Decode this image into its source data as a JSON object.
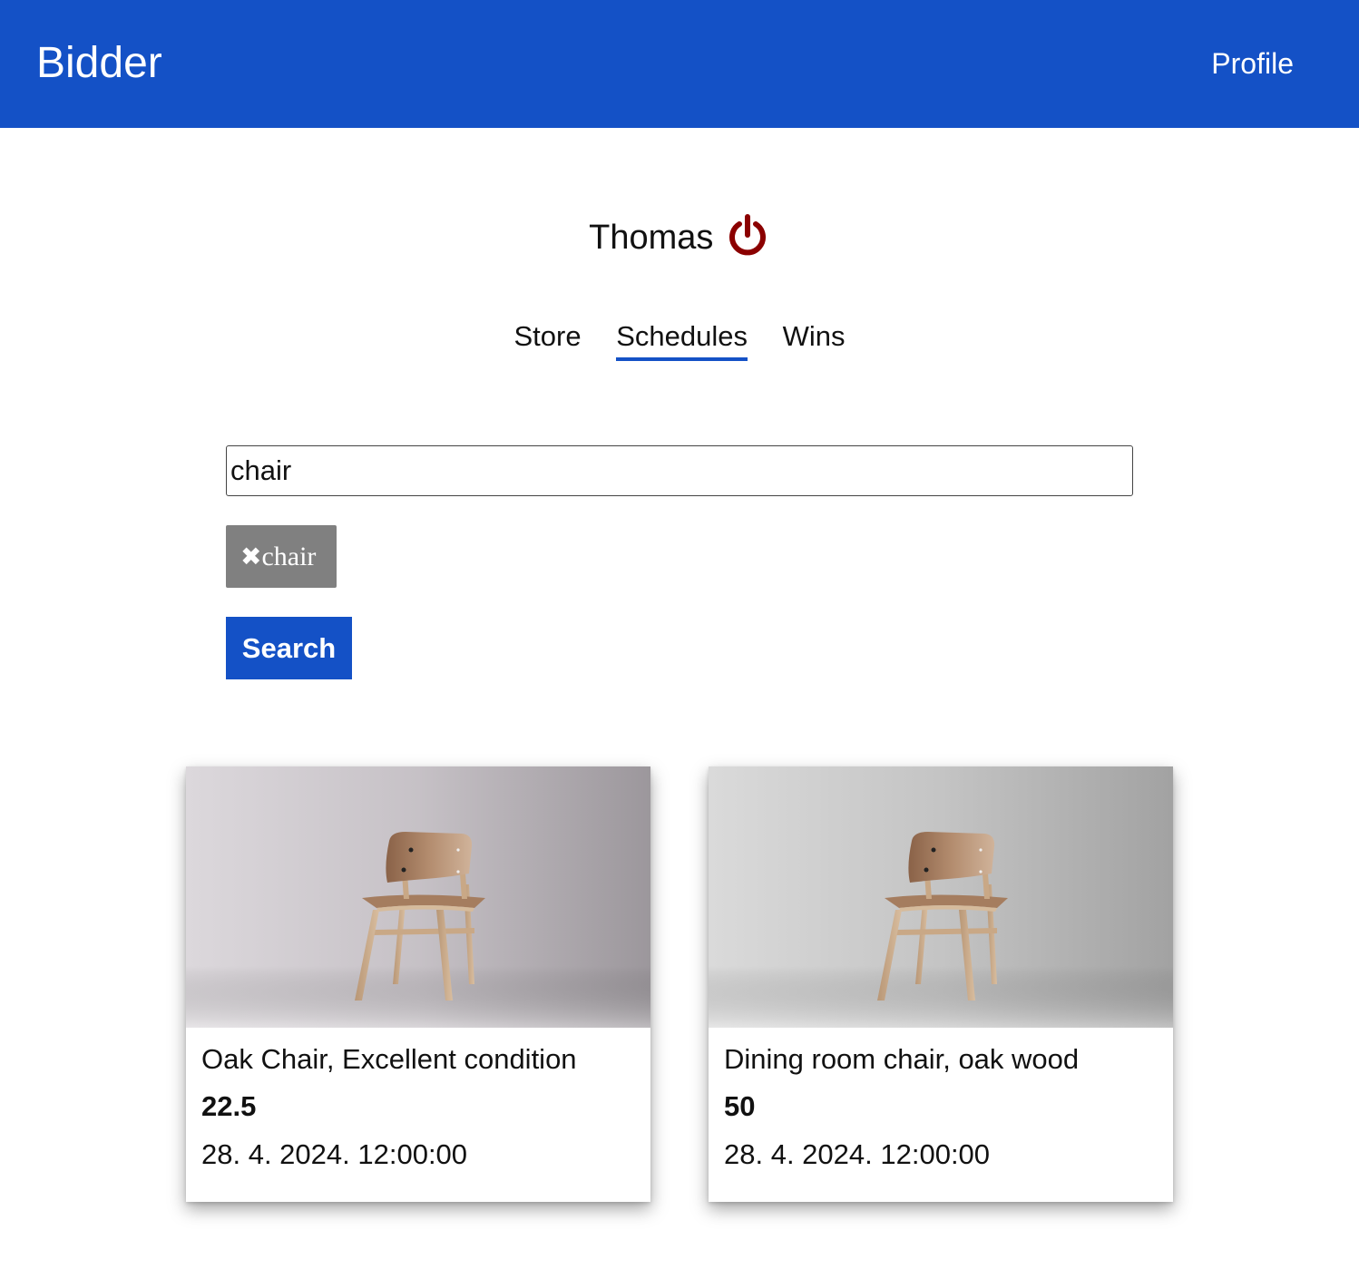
{
  "header": {
    "brand": "Bidder",
    "profile_link": "Profile",
    "background_color": "#1451c6"
  },
  "user": {
    "name": "Thomas",
    "logout_icon": "power-icon",
    "logout_icon_color": "#8b0000"
  },
  "tabs": [
    {
      "label": "Store",
      "active": false
    },
    {
      "label": "Schedules",
      "active": true
    },
    {
      "label": "Wins",
      "active": false
    }
  ],
  "search": {
    "value": "chair",
    "button_label": "Search"
  },
  "tags": [
    {
      "label": "chair",
      "remove_icon": "close-icon"
    }
  ],
  "items": [
    {
      "title": "Oak Chair, Excellent condition",
      "price": "22.5",
      "date": "28. 4. 2024. 12:00:00",
      "image": "wooden-chair-photo"
    },
    {
      "title": "Dining room chair, oak wood",
      "price": "50",
      "date": "28. 4. 2024. 12:00:00",
      "image": "wooden-chair-photo"
    }
  ]
}
